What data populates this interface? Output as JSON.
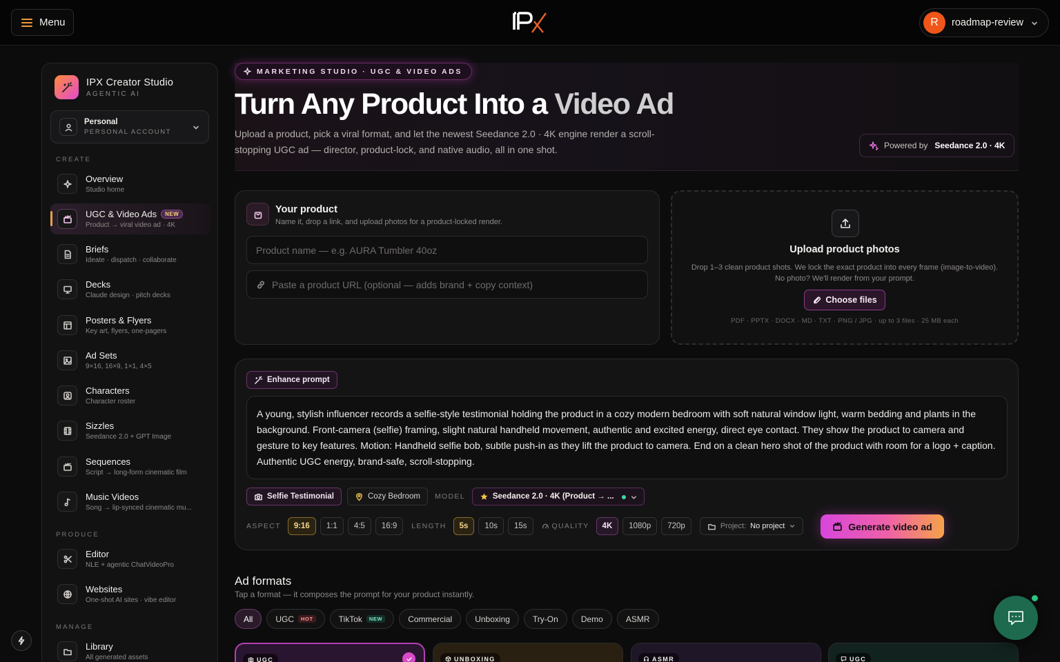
{
  "topbar": {
    "menu_label": "Menu",
    "account_initial": "R",
    "account_name": "roadmap-review"
  },
  "sidebar": {
    "brand_title": "IPX Creator Studio",
    "brand_sub": "AGENTIC AI",
    "workspace_title": "Personal",
    "workspace_sub": "PERSONAL ACCOUNT",
    "sections": {
      "create": "CREATE",
      "produce": "PRODUCE",
      "manage": "MANAGE"
    },
    "items": [
      {
        "label": "Overview",
        "sub": "Studio home",
        "icon": "sparkle-icon"
      },
      {
        "label": "UGC & Video Ads",
        "sub": "Product → viral video ad · 4K",
        "icon": "clapper-icon",
        "badge": "NEW",
        "active": true
      },
      {
        "label": "Briefs",
        "sub": "Ideate · dispatch · collaborate",
        "icon": "document-icon"
      },
      {
        "label": "Decks",
        "sub": "Claude design · pitch decks",
        "icon": "presentation-icon"
      },
      {
        "label": "Posters & Flyers",
        "sub": "Key art, flyers, one-pagers",
        "icon": "layout-icon"
      },
      {
        "label": "Ad Sets",
        "sub": "9×16, 16×9, 1×1, 4×5",
        "icon": "image-icon"
      },
      {
        "label": "Characters",
        "sub": "Character roster",
        "icon": "portrait-icon"
      },
      {
        "label": "Sizzles",
        "sub": "Seedance 2.0 + GPT Image",
        "icon": "film-icon"
      },
      {
        "label": "Sequences",
        "sub": "Script → long-form cinematic film",
        "icon": "clapper-icon"
      },
      {
        "label": "Music Videos",
        "sub": "Song → lip-synced cinematic mu...",
        "icon": "music-icon"
      },
      {
        "label": "Editor",
        "sub": "NLE + agentic ChatVideoPro",
        "icon": "scissors-icon"
      },
      {
        "label": "Websites",
        "sub": "One-shot AI sites · vibe editor",
        "icon": "globe-icon"
      },
      {
        "label": "Library",
        "sub": "All generated assets",
        "icon": "folder-icon"
      }
    ]
  },
  "hero": {
    "eyebrow": "MARKETING STUDIO · UGC & VIDEO ADS",
    "title_main": "Turn Any Product Into a ",
    "title_fade": "Video Ad",
    "description": "Upload a product, pick a viral format, and let the newest Seedance 2.0 · 4K engine render a scroll-stopping UGC ad — director, product-lock, and native audio, all in one shot.",
    "powered_label": "Powered by",
    "powered_value": "Seedance 2.0 · 4K"
  },
  "product": {
    "title": "Your product",
    "subtitle": "Name it, drop a link, and upload photos for a product-locked render.",
    "name_placeholder": "Product name — e.g. AURA Tumbler 40oz",
    "url_placeholder": "Paste a product URL (optional — adds brand + copy context)"
  },
  "upload": {
    "title": "Upload product photos",
    "description": "Drop 1–3 clean product shots. We lock the exact product into every frame (image-to-video). No photo? We'll render from your prompt.",
    "button": "Choose files",
    "types": "PDF · PPTX · DOCX · MD · TXT · PNG / JPG · up to 3 files · 25 MB each"
  },
  "prompt": {
    "enhance_label": "Enhance prompt",
    "text": "A young, stylish influencer records a selfie-style testimonial holding the product in a cozy modern bedroom with soft natural window light, warm bedding and plants in the background. Front-camera (selfie) framing, slight natural handheld movement, authentic and excited energy, direct eye contact. They show the product to camera and gesture to key features. Motion: Handheld selfie bob, subtle push-in as they lift the product to camera. End on a clean hero shot of the product with room for a logo + caption. Authentic UGC energy, brand-safe, scroll-stopping.",
    "format_chip": "Selfie Testimonial",
    "setting_chip": "Cozy Bedroom",
    "model_label": "MODEL",
    "model_value": "Seedance 2.0 · 4K (Product → ...",
    "aspect_label": "ASPECT",
    "aspects": [
      "9:16",
      "1:1",
      "4:5",
      "16:9"
    ],
    "aspect_selected": "9:16",
    "length_label": "LENGTH",
    "lengths": [
      "5s",
      "10s",
      "15s"
    ],
    "length_selected": "5s",
    "quality_label": "QUALITY",
    "qualities": [
      "4K",
      "1080p",
      "720p"
    ],
    "quality_selected": "4K",
    "project_label": "Project:",
    "project_value": "No project",
    "generate_label": "Generate video ad"
  },
  "formats": {
    "title": "Ad formats",
    "subtitle": "Tap a format — it composes the prompt for your product instantly.",
    "filters": [
      {
        "label": "All",
        "selected": true
      },
      {
        "label": "UGC",
        "tag": "HOT"
      },
      {
        "label": "TikTok",
        "tag": "NEW"
      },
      {
        "label": "Commercial"
      },
      {
        "label": "Unboxing"
      },
      {
        "label": "Try-On"
      },
      {
        "label": "Demo"
      },
      {
        "label": "ASMR"
      }
    ],
    "cards": [
      {
        "tag": "UGC",
        "selected": true,
        "color": "#2a1530"
      },
      {
        "tag": "UNBOXING",
        "color": "#2a2012"
      },
      {
        "tag": "ASMR",
        "color": "#1f1628"
      },
      {
        "tag": "UGC",
        "color": "#11221f"
      }
    ]
  },
  "colors": {
    "accent_pink": "#d846dc",
    "accent_gold": "#f5a24a",
    "chat_green": "#1e6a4e"
  }
}
